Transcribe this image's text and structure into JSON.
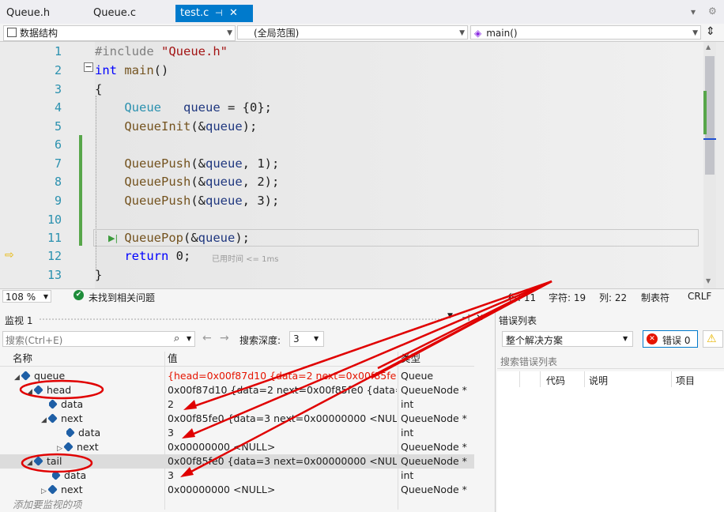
{
  "tabs": [
    {
      "label": "Queue.h"
    },
    {
      "label": "Queue.c"
    },
    {
      "label": "test.c",
      "pin": "⊣",
      "close": "✕"
    }
  ],
  "tabbar_right": {
    "dropdown": "▾",
    "gear": "⚙"
  },
  "nav": {
    "project": "数据结构",
    "scope": "(全局范围)",
    "function": "main()"
  },
  "editor": {
    "line_numbers": [
      "1",
      "2",
      "3",
      "4",
      "5",
      "6",
      "7",
      "8",
      "9",
      "10",
      "11",
      "12",
      "13"
    ],
    "perf_tip": "已用时间 <= 1ms"
  },
  "status": {
    "zoom": "108 %",
    "issues": "未找到相关问题",
    "line": "行: 11",
    "char": "字符: 19",
    "col": "列: 22",
    "tab": "制表符",
    "eol": "CRLF"
  },
  "watch": {
    "title": "监视 1",
    "search_placeholder": "搜索(Ctrl+E)",
    "depth_label": "搜索深度:",
    "depth_value": "3",
    "columns": {
      "name": "名称",
      "value": "值",
      "type": "类型"
    },
    "rows": [
      {
        "name": "queue",
        "value": "{head=0x00f87d10 {data=2 next=0x00f85fe0 {da...",
        "type": "Queue"
      },
      {
        "name": "head",
        "value": "0x00f87d10 {data=2 next=0x00f85fe0 {data=3 n...",
        "type": "QueueNode *"
      },
      {
        "name": "data",
        "value": "2",
        "type": "int"
      },
      {
        "name": "next",
        "value": "0x00f85fe0 {data=3 next=0x00000000 <NULL> }",
        "type": "QueueNode *"
      },
      {
        "name": "data",
        "value": "3",
        "type": "int"
      },
      {
        "name": "next",
        "value": "0x00000000 <NULL>",
        "type": "QueueNode *"
      },
      {
        "name": "tail",
        "value": "0x00f85fe0 {data=3 next=0x00000000 <NULL> }",
        "type": "QueueNode *"
      },
      {
        "name": "data",
        "value": "3",
        "type": "int"
      },
      {
        "name": "next",
        "value": "0x00000000 <NULL>",
        "type": "QueueNode *"
      }
    ],
    "add_item": "添加要监视的项"
  },
  "errors": {
    "title": "错误列表",
    "scope": "整个解决方案",
    "error_count": "错误 0",
    "search_placeholder": "搜索错误列表",
    "columns": {
      "code": "代码",
      "desc": "说明",
      "project": "项目"
    }
  },
  "colors": {
    "accent": "#007acc",
    "annotation": "#e00000",
    "changed_value": "#e51400"
  }
}
